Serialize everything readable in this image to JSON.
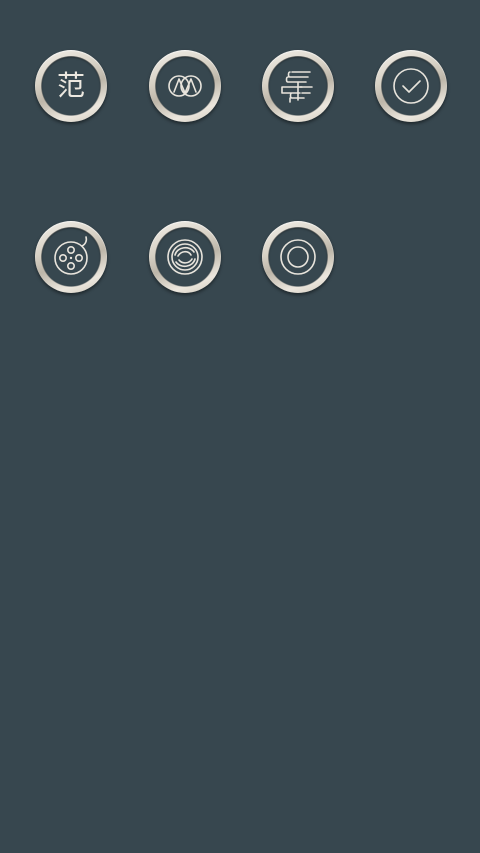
{
  "screen": {
    "background_color": "#37474f"
  },
  "icons": [
    {
      "name": "fan-character-icon",
      "glyph": "范"
    },
    {
      "name": "overlapping-circles-icon"
    },
    {
      "name": "stacked-lines-logo-icon"
    },
    {
      "name": "check-circle-icon"
    },
    {
      "name": "film-reel-icon"
    },
    {
      "name": "interlocking-s-logo-icon"
    },
    {
      "name": "concentric-circles-icon"
    }
  ]
}
